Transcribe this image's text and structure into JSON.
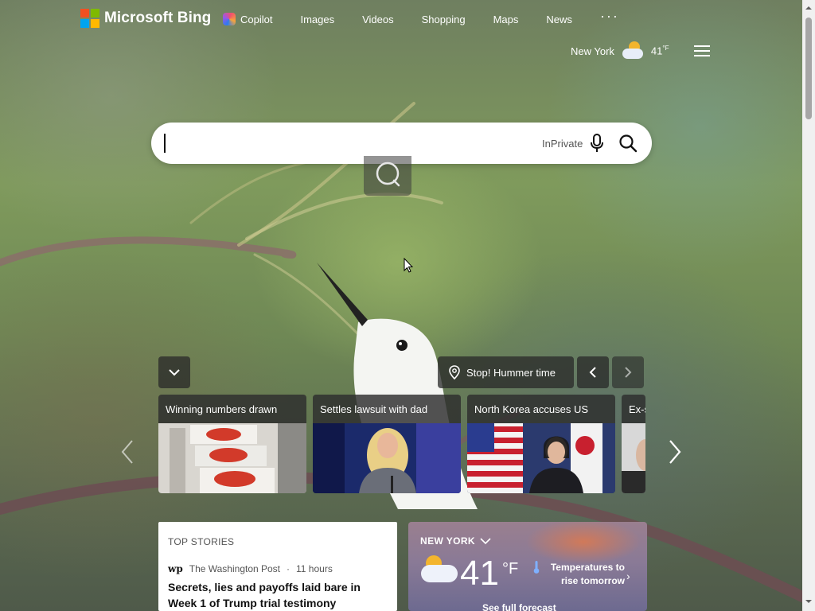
{
  "header": {
    "logo_text": "Microsoft Bing",
    "nav": [
      {
        "label": "Copilot",
        "icon": "copilot-icon"
      },
      {
        "label": "Images"
      },
      {
        "label": "Videos"
      },
      {
        "label": "Shopping"
      },
      {
        "label": "Maps"
      },
      {
        "label": "News"
      }
    ],
    "more": "···",
    "location": "New York",
    "weather_icon": "partly-cloudy-icon",
    "temperature": "41",
    "temperature_unit": "°F"
  },
  "search": {
    "value": "",
    "inprivate_label": "InPrivate",
    "icons": [
      "microphone-icon",
      "search-icon",
      "visual-search-icon"
    ]
  },
  "image_of_day": {
    "title": "Stop! Hummer time",
    "icons": [
      "chevron-down-icon",
      "location-pin-icon",
      "chevron-left-icon",
      "chevron-right-icon"
    ]
  },
  "news_carousel": {
    "items": [
      {
        "title": "Winning numbers drawn"
      },
      {
        "title": "Settles lawsuit with dad"
      },
      {
        "title": "North Korea accuses US"
      },
      {
        "title": "Ex-s"
      }
    ]
  },
  "top_stories": {
    "heading": "TOP STORIES",
    "source_logo": "wp",
    "source": "The Washington Post",
    "age": "11 hours",
    "separator": "·",
    "headline": "Secrets, lies and payoffs laid bare in Week 1 of Trump trial testimony"
  },
  "weather_card": {
    "city": "NEW YORK",
    "temperature": "41",
    "unit": "°F",
    "description": "Temperatures to rise tomorrow",
    "link": "See full forecast",
    "colors": {
      "sun": "#f3b52e",
      "cloud": "#eef2fa"
    }
  },
  "colors": {
    "ms_red": "#f25022",
    "ms_green": "#7fba00",
    "ms_blue": "#00a4ef",
    "ms_yellow": "#ffb900"
  }
}
